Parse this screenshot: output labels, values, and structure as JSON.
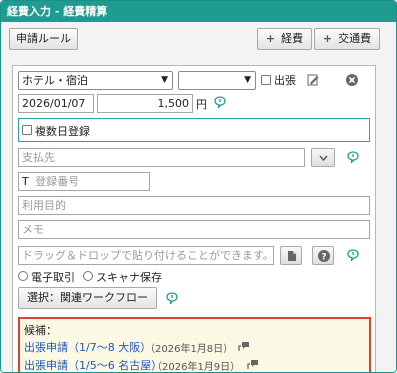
{
  "dialog": {
    "title": "経費入力 - 経費精算"
  },
  "toolbar": {
    "rules_label": "申請ルール",
    "add_expense_label": "経費",
    "add_transport_label": "交通費"
  },
  "form": {
    "category_value": "ホテル・宿泊",
    "sub_select_value": "",
    "business_trip_label": "出張",
    "date_value": "2026/01/07",
    "amount_value": "1,500",
    "currency_label": "円",
    "multi_day_label": "複数日登録",
    "payee_placeholder": "支払先",
    "reg_prefix": "T",
    "reg_placeholder": "登録番号",
    "purpose_placeholder": "利用目的",
    "memo_placeholder": "メモ",
    "drop_placeholder": "ドラッグ＆ドロップで貼り付けることができます。",
    "radio_electronic": "電子取引",
    "radio_scanner": "スキャナ保存",
    "workflow_button": "選択：関連ワークフロー"
  },
  "candidates": {
    "title": "候補：",
    "items": [
      {
        "label": "出張申請（1/7〜8 大阪）",
        "date": "（2026年1月8日）"
      },
      {
        "label": "出張申請（1/5〜6 名古屋）",
        "date": "（2026年1月9日）"
      }
    ]
  },
  "colors": {
    "titlebar": "#1f9c92",
    "accent_icon": "#1aa093",
    "highlight_border": "#d9442e",
    "link": "#2157b8"
  }
}
